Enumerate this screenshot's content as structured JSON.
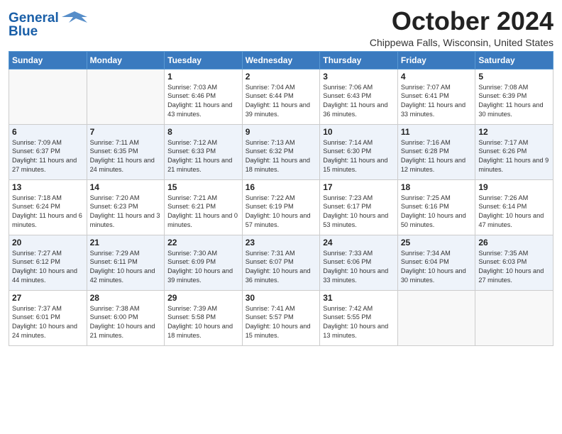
{
  "header": {
    "logo_line1": "General",
    "logo_line2": "Blue",
    "month": "October 2024",
    "location": "Chippewa Falls, Wisconsin, United States"
  },
  "days_of_week": [
    "Sunday",
    "Monday",
    "Tuesday",
    "Wednesday",
    "Thursday",
    "Friday",
    "Saturday"
  ],
  "weeks": [
    [
      {
        "day": "",
        "info": ""
      },
      {
        "day": "",
        "info": ""
      },
      {
        "day": "1",
        "info": "Sunrise: 7:03 AM\nSunset: 6:46 PM\nDaylight: 11 hours and 43 minutes."
      },
      {
        "day": "2",
        "info": "Sunrise: 7:04 AM\nSunset: 6:44 PM\nDaylight: 11 hours and 39 minutes."
      },
      {
        "day": "3",
        "info": "Sunrise: 7:06 AM\nSunset: 6:43 PM\nDaylight: 11 hours and 36 minutes."
      },
      {
        "day": "4",
        "info": "Sunrise: 7:07 AM\nSunset: 6:41 PM\nDaylight: 11 hours and 33 minutes."
      },
      {
        "day": "5",
        "info": "Sunrise: 7:08 AM\nSunset: 6:39 PM\nDaylight: 11 hours and 30 minutes."
      }
    ],
    [
      {
        "day": "6",
        "info": "Sunrise: 7:09 AM\nSunset: 6:37 PM\nDaylight: 11 hours and 27 minutes."
      },
      {
        "day": "7",
        "info": "Sunrise: 7:11 AM\nSunset: 6:35 PM\nDaylight: 11 hours and 24 minutes."
      },
      {
        "day": "8",
        "info": "Sunrise: 7:12 AM\nSunset: 6:33 PM\nDaylight: 11 hours and 21 minutes."
      },
      {
        "day": "9",
        "info": "Sunrise: 7:13 AM\nSunset: 6:32 PM\nDaylight: 11 hours and 18 minutes."
      },
      {
        "day": "10",
        "info": "Sunrise: 7:14 AM\nSunset: 6:30 PM\nDaylight: 11 hours and 15 minutes."
      },
      {
        "day": "11",
        "info": "Sunrise: 7:16 AM\nSunset: 6:28 PM\nDaylight: 11 hours and 12 minutes."
      },
      {
        "day": "12",
        "info": "Sunrise: 7:17 AM\nSunset: 6:26 PM\nDaylight: 11 hours and 9 minutes."
      }
    ],
    [
      {
        "day": "13",
        "info": "Sunrise: 7:18 AM\nSunset: 6:24 PM\nDaylight: 11 hours and 6 minutes."
      },
      {
        "day": "14",
        "info": "Sunrise: 7:20 AM\nSunset: 6:23 PM\nDaylight: 11 hours and 3 minutes."
      },
      {
        "day": "15",
        "info": "Sunrise: 7:21 AM\nSunset: 6:21 PM\nDaylight: 11 hours and 0 minutes."
      },
      {
        "day": "16",
        "info": "Sunrise: 7:22 AM\nSunset: 6:19 PM\nDaylight: 10 hours and 57 minutes."
      },
      {
        "day": "17",
        "info": "Sunrise: 7:23 AM\nSunset: 6:17 PM\nDaylight: 10 hours and 53 minutes."
      },
      {
        "day": "18",
        "info": "Sunrise: 7:25 AM\nSunset: 6:16 PM\nDaylight: 10 hours and 50 minutes."
      },
      {
        "day": "19",
        "info": "Sunrise: 7:26 AM\nSunset: 6:14 PM\nDaylight: 10 hours and 47 minutes."
      }
    ],
    [
      {
        "day": "20",
        "info": "Sunrise: 7:27 AM\nSunset: 6:12 PM\nDaylight: 10 hours and 44 minutes."
      },
      {
        "day": "21",
        "info": "Sunrise: 7:29 AM\nSunset: 6:11 PM\nDaylight: 10 hours and 42 minutes."
      },
      {
        "day": "22",
        "info": "Sunrise: 7:30 AM\nSunset: 6:09 PM\nDaylight: 10 hours and 39 minutes."
      },
      {
        "day": "23",
        "info": "Sunrise: 7:31 AM\nSunset: 6:07 PM\nDaylight: 10 hours and 36 minutes."
      },
      {
        "day": "24",
        "info": "Sunrise: 7:33 AM\nSunset: 6:06 PM\nDaylight: 10 hours and 33 minutes."
      },
      {
        "day": "25",
        "info": "Sunrise: 7:34 AM\nSunset: 6:04 PM\nDaylight: 10 hours and 30 minutes."
      },
      {
        "day": "26",
        "info": "Sunrise: 7:35 AM\nSunset: 6:03 PM\nDaylight: 10 hours and 27 minutes."
      }
    ],
    [
      {
        "day": "27",
        "info": "Sunrise: 7:37 AM\nSunset: 6:01 PM\nDaylight: 10 hours and 24 minutes."
      },
      {
        "day": "28",
        "info": "Sunrise: 7:38 AM\nSunset: 6:00 PM\nDaylight: 10 hours and 21 minutes."
      },
      {
        "day": "29",
        "info": "Sunrise: 7:39 AM\nSunset: 5:58 PM\nDaylight: 10 hours and 18 minutes."
      },
      {
        "day": "30",
        "info": "Sunrise: 7:41 AM\nSunset: 5:57 PM\nDaylight: 10 hours and 15 minutes."
      },
      {
        "day": "31",
        "info": "Sunrise: 7:42 AM\nSunset: 5:55 PM\nDaylight: 10 hours and 13 minutes."
      },
      {
        "day": "",
        "info": ""
      },
      {
        "day": "",
        "info": ""
      }
    ]
  ]
}
